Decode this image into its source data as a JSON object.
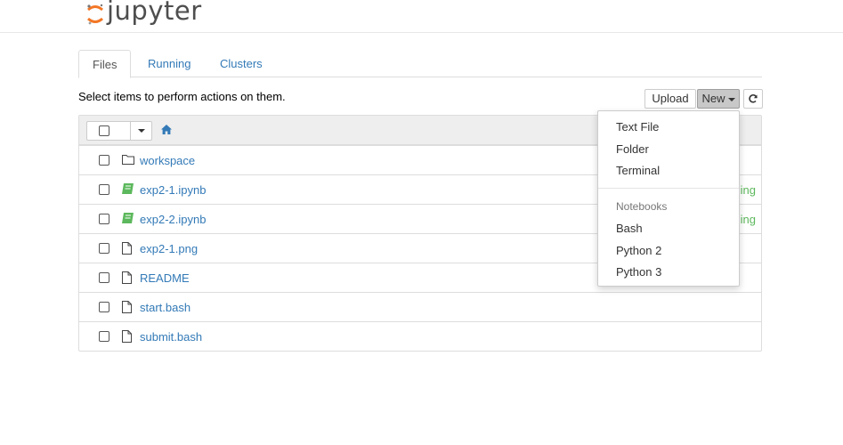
{
  "app": {
    "logo_text": "jupyter"
  },
  "tabs": [
    {
      "label": "Files",
      "active": true
    },
    {
      "label": "Running",
      "active": false
    },
    {
      "label": "Clusters",
      "active": false
    }
  ],
  "toolbar": {
    "hint": "Select items to perform actions on them.",
    "upload_label": "Upload",
    "new_label": "New",
    "refresh_icon": "refresh-icon"
  },
  "file_list": {
    "home_icon": "home-icon",
    "rows": [
      {
        "name": "workspace",
        "icon": "folder-icon",
        "status": ""
      },
      {
        "name": "exp2-1.ipynb",
        "icon": "notebook-icon",
        "status": "Running"
      },
      {
        "name": "exp2-2.ipynb",
        "icon": "notebook-icon",
        "status": "Running"
      },
      {
        "name": "exp2-1.png",
        "icon": "file-icon",
        "status": ""
      },
      {
        "name": "README",
        "icon": "file-icon",
        "status": ""
      },
      {
        "name": "start.bash",
        "icon": "file-icon",
        "status": ""
      },
      {
        "name": "submit.bash",
        "icon": "file-icon",
        "status": ""
      }
    ]
  },
  "new_menu": {
    "items": [
      "Text File",
      "Folder",
      "Terminal"
    ],
    "notebooks_header": "Notebooks",
    "kernels": [
      "Bash",
      "Python 2",
      "Python 3"
    ]
  },
  "colors": {
    "link": "#337ab7",
    "running": "#5cb85c",
    "logo_orange": "#f37726"
  }
}
